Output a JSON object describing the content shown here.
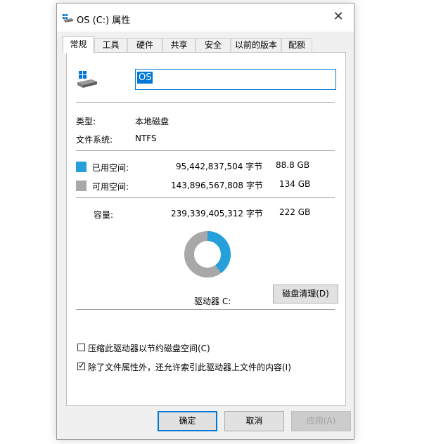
{
  "window": {
    "title": "OS (C:) 属性",
    "close_glyph": "✕"
  },
  "tabs": [
    {
      "label": "常规",
      "active": true
    },
    {
      "label": "工具",
      "active": false
    },
    {
      "label": "硬件",
      "active": false
    },
    {
      "label": "共享",
      "active": false
    },
    {
      "label": "安全",
      "active": false
    },
    {
      "label": "以前的版本",
      "active": false
    },
    {
      "label": "配额",
      "active": false
    }
  ],
  "general": {
    "volume_name": "OS",
    "type_label": "类型:",
    "type_value": "本地磁盘",
    "fs_label": "文件系统:",
    "fs_value": "NTFS",
    "used_label": "已用空间:",
    "used_bytes": "95,442,837,504 字节",
    "used_size": "88.8 GB",
    "free_label": "可用空间:",
    "free_bytes": "143,896,567,808 字节",
    "free_size": "134 GB",
    "capacity_label": "容量:",
    "capacity_bytes": "239,339,405,312 字节",
    "capacity_size": "222 GB",
    "drive_label": "驱动器 C:",
    "cleanup_button": "磁盘清理(D)",
    "compress_label": "压缩此驱动器以节约磁盘空间(C)",
    "compress_checked": false,
    "index_label": "除了文件属性外，还允许索引此驱动器上文件的内容(I)",
    "index_checked": true
  },
  "usage": {
    "used_fraction": 0.3988,
    "used_color": "#26a0da",
    "free_color": "#a8a8a8"
  },
  "buttons": {
    "ok": "确定",
    "cancel": "取消",
    "apply": "应用(A)"
  },
  "icons": {
    "title": "drive-icon",
    "close": "close-icon",
    "drive": "windows-drive-icon",
    "checkmark": "checkmark-icon"
  }
}
